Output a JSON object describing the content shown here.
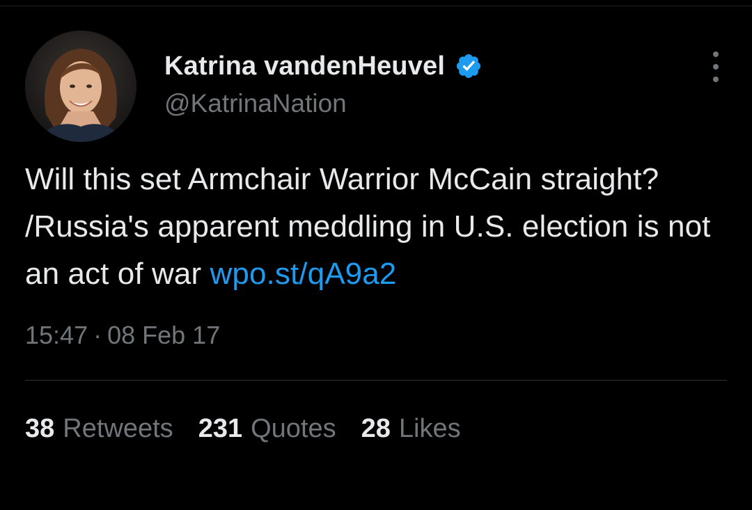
{
  "tweet": {
    "author": {
      "display_name": "Katrina vandenHeuvel",
      "handle": "@KatrinaNation",
      "verified": true
    },
    "text": "Will this set Armchair Warrior McCain straight? /Russia's apparent meddling in U.S. election is not an act of war ",
    "link": {
      "text": "wpo.st/​qA9a2"
    },
    "time": "15:47",
    "separator": "·",
    "date": "08 Feb 17"
  },
  "stats": [
    {
      "count": "38",
      "label": "Retweets"
    },
    {
      "count": "231",
      "label": "Quotes"
    },
    {
      "count": "28",
      "label": "Likes"
    }
  ],
  "colors": {
    "background": "#000000",
    "text_primary": "#e7e9ea",
    "text_secondary": "#71767b",
    "link": "#1d9bf0",
    "verified_badge": "#1d9bf0"
  },
  "icons": {
    "verified": "verified-badge-icon",
    "more": "more-vertical-icon"
  }
}
